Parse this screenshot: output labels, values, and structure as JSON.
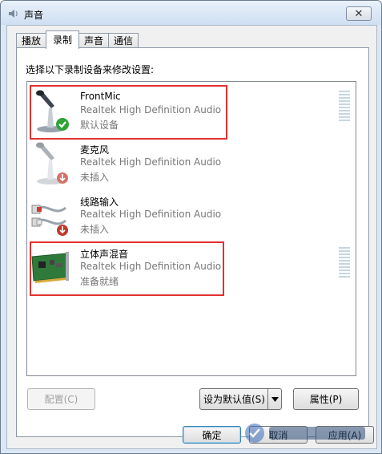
{
  "window": {
    "title": "声音",
    "close_label": "✕"
  },
  "tabs": [
    {
      "label": "播放",
      "active": false
    },
    {
      "label": "录制",
      "active": true
    },
    {
      "label": "声音",
      "active": false
    },
    {
      "label": "通信",
      "active": false
    }
  ],
  "instruction": "选择以下录制设备来修改设置:",
  "devices": [
    {
      "name": "FrontMic",
      "driver": "Realtek High Definition Audio",
      "status": "默认设备",
      "icon": "microphone-icon",
      "badge": "default-check-icon",
      "highlighted": true
    },
    {
      "name": "麦克风",
      "driver": "Realtek High Definition Audio",
      "status": "未插入",
      "icon": "microphone-icon",
      "badge": "unplugged-icon",
      "highlighted": false
    },
    {
      "name": "线路输入",
      "driver": "Realtek High Definition Audio",
      "status": "未插入",
      "icon": "line-in-cable-icon",
      "badge": "unplugged-icon",
      "highlighted": false
    },
    {
      "name": "立体声混音",
      "driver": "Realtek High Definition Audio",
      "status": "准备就绪",
      "icon": "sound-card-icon",
      "badge": "",
      "highlighted": true
    }
  ],
  "buttons": {
    "configure": "配置(C)",
    "set_default": "设为默认值(S)",
    "properties": "属性(P)",
    "ok": "确定",
    "cancel": "取消",
    "apply": "应用(A)"
  },
  "colors": {
    "highlight": "#e0332e",
    "check": "#2fa33a",
    "unplugged": "#c0392b"
  }
}
